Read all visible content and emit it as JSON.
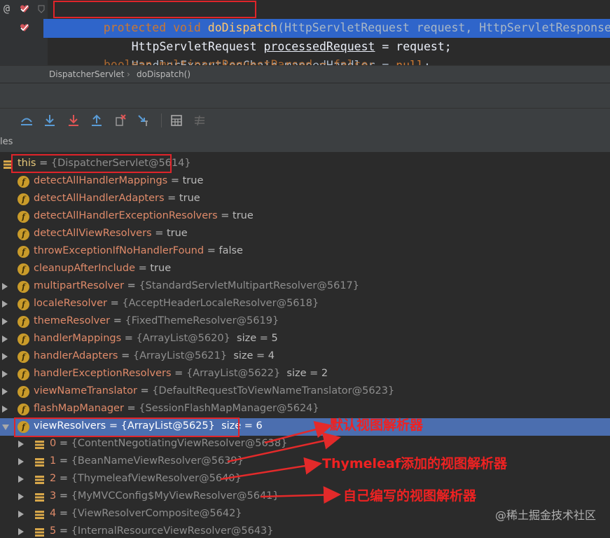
{
  "editor": {
    "line1": {
      "kw": "protected void ",
      "fn": "doDispatch",
      "rest": "(HttpServletRequest request, HttpServletResponse res"
    },
    "line2": {
      "type": "HttpServletRequest ",
      "var": "processedRequest",
      "rest": " = request;"
    },
    "line3": {
      "type": "HandlerExecutionChain ",
      "var": "mappedHandler",
      "eq": " = ",
      "val": "null",
      "end": ";"
    },
    "line4": {
      "text": "boolean multipartRequestParsed = false;"
    }
  },
  "breadcrumb": {
    "class": "DispatcherServlet",
    "sep": "›",
    "method": "doDispatch()"
  },
  "vars_header": {
    "label": "les"
  },
  "tree": [
    {
      "kind": "this",
      "name": "this",
      "eq": " = ",
      "ref": "{DispatcherServlet@5614}"
    },
    {
      "kind": "field",
      "name": "detectAllHandlerMappings",
      "eq": " = ",
      "val": "true"
    },
    {
      "kind": "field",
      "name": "detectAllHandlerAdapters",
      "eq": " = ",
      "val": "true"
    },
    {
      "kind": "field",
      "name": "detectAllHandlerExceptionResolvers",
      "eq": " = ",
      "val": "true"
    },
    {
      "kind": "field",
      "name": "detectAllViewResolvers",
      "eq": " = ",
      "val": "true"
    },
    {
      "kind": "field",
      "name": "throwExceptionIfNoHandlerFound",
      "eq": " = ",
      "val": "false"
    },
    {
      "kind": "field",
      "name": "cleanupAfterInclude",
      "eq": " = ",
      "val": "true"
    },
    {
      "kind": "field-exp",
      "name": "multipartResolver",
      "eq": " = ",
      "ref": "{StandardServletMultipartResolver@5617}"
    },
    {
      "kind": "field-exp",
      "name": "localeResolver",
      "eq": " = ",
      "ref": "{AcceptHeaderLocaleResolver@5618}"
    },
    {
      "kind": "field-exp",
      "name": "themeResolver",
      "eq": " = ",
      "ref": "{FixedThemeResolver@5619}"
    },
    {
      "kind": "field-exp",
      "name": "handlerMappings",
      "eq": " = ",
      "ref": "{ArrayList@5620}",
      "sz": "size = 5"
    },
    {
      "kind": "field-exp",
      "name": "handlerAdapters",
      "eq": " = ",
      "ref": "{ArrayList@5621}",
      "sz": "size = 4"
    },
    {
      "kind": "field-exp",
      "name": "handlerExceptionResolvers",
      "eq": " = ",
      "ref": "{ArrayList@5622}",
      "sz": "size = 2"
    },
    {
      "kind": "field-exp",
      "name": "viewNameTranslator",
      "eq": " = ",
      "ref": "{DefaultRequestToViewNameTranslator@5623}"
    },
    {
      "kind": "field-exp",
      "name": "flashMapManager",
      "eq": " = ",
      "ref": "{SessionFlashMapManager@5624}"
    },
    {
      "kind": "field-open",
      "name": "viewResolvers",
      "eq": " = ",
      "ref": "{ArrayList@5625}",
      "sz": "size = 6"
    },
    {
      "kind": "elem",
      "name": "0",
      "eq": " = ",
      "ref": "{ContentNegotiatingViewResolver@5638}"
    },
    {
      "kind": "elem",
      "name": "1",
      "eq": " = ",
      "ref": "{BeanNameViewResolver@5639}"
    },
    {
      "kind": "elem",
      "name": "2",
      "eq": " = ",
      "ref": "{ThymeleafViewResolver@5640}"
    },
    {
      "kind": "elem",
      "name": "3",
      "eq": " = ",
      "ref": "{MyMVCConfig$MyViewResolver@5641}"
    },
    {
      "kind": "elem",
      "name": "4",
      "eq": " = ",
      "ref": "{ViewResolverComposite@5642}"
    },
    {
      "kind": "elem",
      "name": "5",
      "eq": " = ",
      "ref": "{InternalResourceViewResolver@5643}"
    }
  ],
  "annotations": {
    "default": "默认视图解析器",
    "thymeleaf": "Thymeleaf添加的视图解析器",
    "custom": "自己编写的视图解析器"
  },
  "watermark": "@稀土掘金技术社区",
  "gutter": {
    "at": "@"
  },
  "colors": {
    "accent_red": "#e0242a",
    "selection": "#4b6eaf",
    "editor_highlight": "#2f65ca"
  }
}
